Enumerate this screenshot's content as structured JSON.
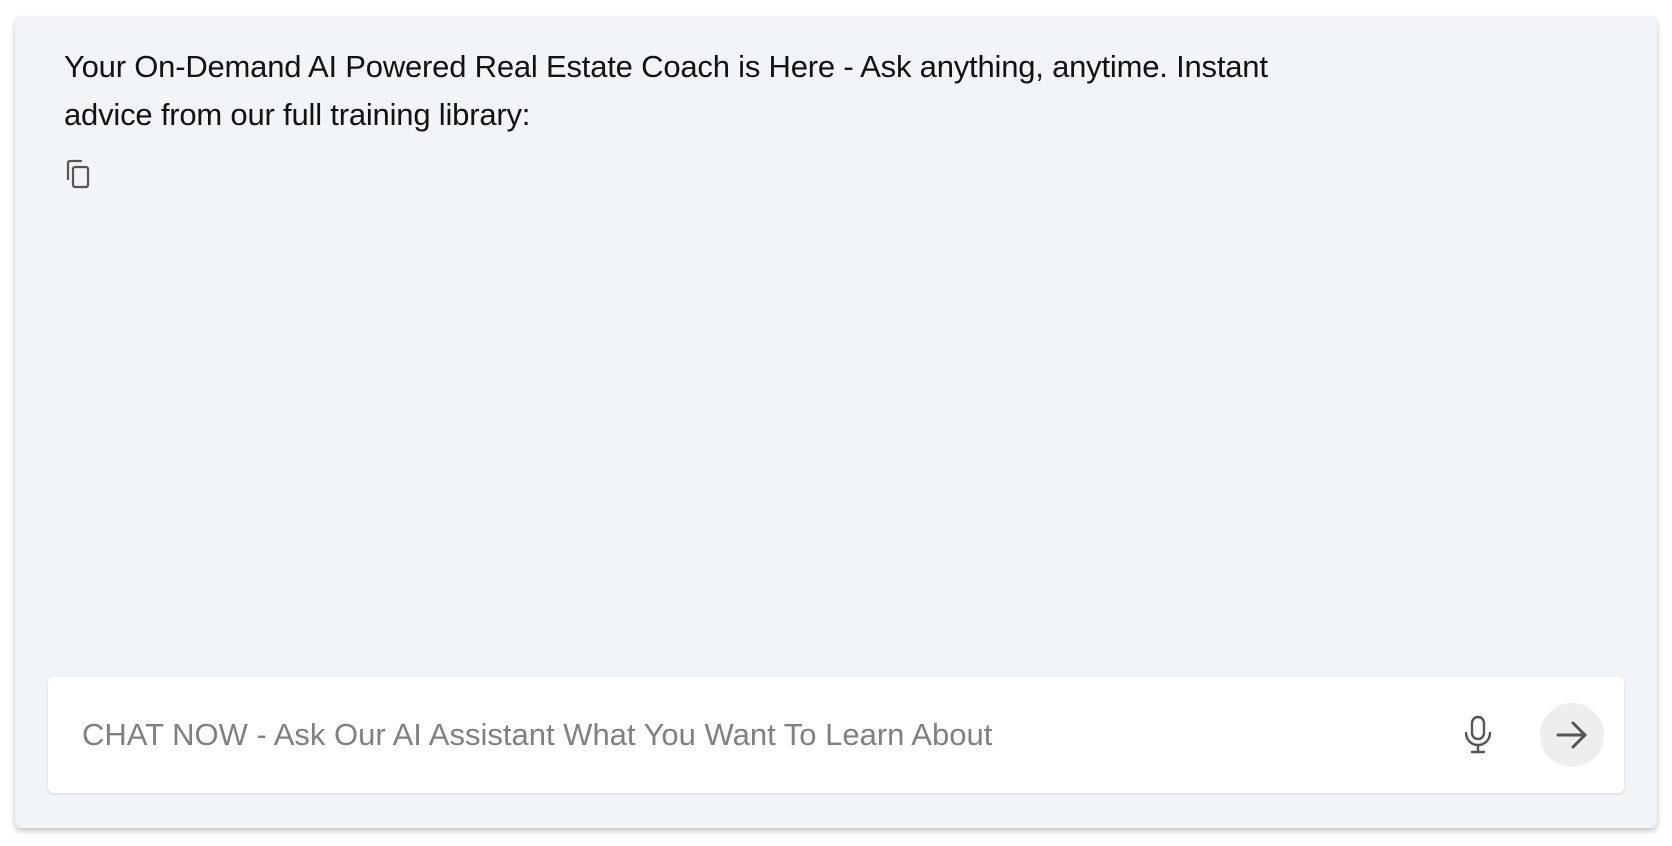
{
  "chat": {
    "message_line1": "Your On-Demand AI Powered Real Estate Coach is Here - Ask anything, anytime. Instant",
    "message_line2": "advice from our full training library:"
  },
  "input": {
    "placeholder": "CHAT NOW - Ask Our AI Assistant What You Want To Learn About",
    "value": ""
  },
  "icons": {
    "copy": "copy-icon",
    "mic": "microphone-icon",
    "send": "arrow-right-icon"
  },
  "colors": {
    "panel_background": "#f1f5f8",
    "input_background": "#ffffff",
    "send_button_background": "#eeeeee",
    "text": "#121212",
    "placeholder": "#808080",
    "icon": "#555555"
  }
}
